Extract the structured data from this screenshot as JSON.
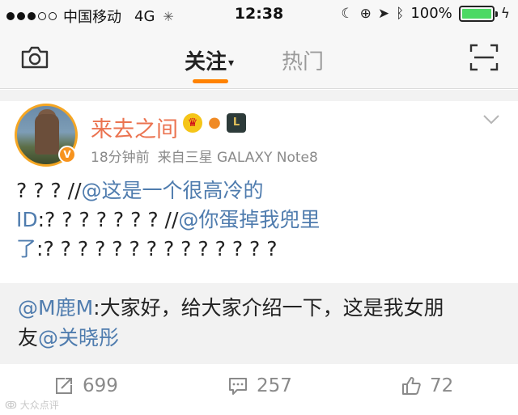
{
  "status_bar": {
    "carrier": "中国移动",
    "network": "4G",
    "time": "12:38",
    "battery_percent": "100%",
    "battery_level": 1.0,
    "colors": {
      "battery": "#4cd964"
    }
  },
  "nav": {
    "tabs": [
      {
        "label": "关注",
        "active": true
      },
      {
        "label": "热门",
        "active": false
      }
    ],
    "caret": "▾",
    "accent_color": "#ff8200"
  },
  "post": {
    "author": "来去之间",
    "time_ago": "18分钟前",
    "source": "来自三星 GALAXY Note8",
    "verified_badge": "V",
    "badges": [
      "crown-icon",
      "balloon-icon",
      "game-icon"
    ],
    "body": {
      "line1_plain": "? ? ? //",
      "line1_mention": "@这是一个很高冷的",
      "line2_mention_end": "ID",
      "line2_plain": ":? ? ? ? ? ? ? //",
      "line2_mention": "@你蛋掉我兜里",
      "line3_mention_end": "了",
      "line3_plain": ":? ? ? ? ? ? ? ? ? ? ? ? ? ?"
    },
    "quoted": {
      "mention": "@M鹿M",
      "text1": ":大家好，给大家介绍一下，这是我女朋",
      "text2_plain": "友",
      "text2_mention": "@关晓彤"
    },
    "actions": {
      "reposts": "699",
      "comments": "257",
      "likes": "72"
    },
    "colors": {
      "username": "#eb7350",
      "mention": "#4f7cae"
    }
  },
  "watermark": "大众点评"
}
